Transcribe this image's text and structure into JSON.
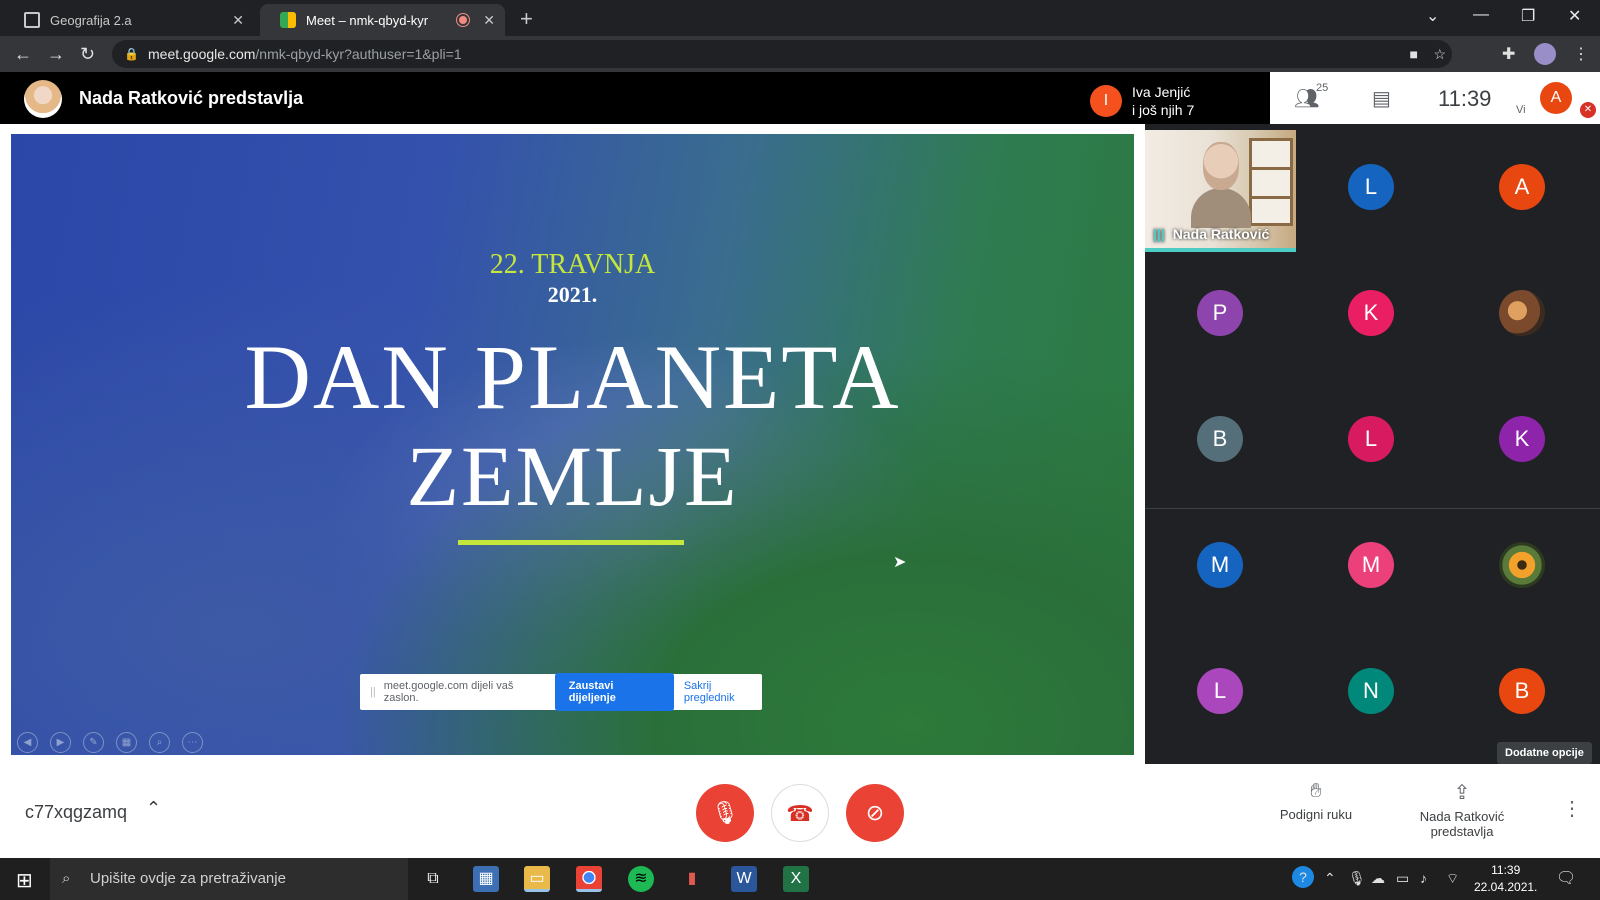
{
  "browser": {
    "tabs": [
      {
        "title": "Geografija 2.a",
        "close": "✕"
      },
      {
        "title": "Meet – nmk-qbyd-kyr",
        "close": "✕",
        "recording": true
      }
    ],
    "new_tab": "+",
    "url_host": "meet.google.com",
    "url_path": "/nmk-qbyd-kyr?authuser=1&pli=1"
  },
  "meet": {
    "presenter_title": "Nada Ratković predstavlja",
    "notification": {
      "initial": "I",
      "line1": "Iva Jenjić",
      "line2": "i još njih 7"
    },
    "participant_count": "25",
    "clock": "11:39",
    "self_label": "Vi",
    "self_initial": "A",
    "presenter_tile_name": "Nada Ratković",
    "participants": [
      {
        "initial": "L",
        "color": "#1565c0"
      },
      {
        "initial": "A",
        "color": "#e8470f"
      },
      {
        "initial": "P",
        "color": "#8e44ad"
      },
      {
        "initial": "K",
        "color": "#e91e63"
      },
      {
        "initial": "",
        "color": "photo"
      },
      {
        "initial": "B",
        "color": "#546e7a"
      },
      {
        "initial": "L",
        "color": "#d81b60"
      },
      {
        "initial": "K",
        "color": "#8e24aa"
      },
      {
        "initial": "M",
        "color": "#1565c0"
      },
      {
        "initial": "M",
        "color": "#ec407a"
      },
      {
        "initial": "",
        "color": "flower"
      },
      {
        "initial": "L",
        "color": "#ab47bc"
      },
      {
        "initial": "N",
        "color": "#00897b"
      },
      {
        "initial": "B",
        "color": "#e8470f"
      }
    ],
    "tooltip": "Dodatne opcije",
    "meeting_code": "c77xqgzamq",
    "raise_hand": "Podigni ruku",
    "presenting_line1": "Nada Ratković",
    "presenting_line2": "predstavlja"
  },
  "slide": {
    "date_line1": "22. TRAVNJA",
    "date_line2": "2021.",
    "title_line1": "DAN PLANETA",
    "title_line2": "ZEMLJE",
    "share_text": "meet.google.com dijeli vaš zaslon.",
    "stop_sharing": "Zaustavi dijeljenje",
    "hide": "Sakrij preglednik"
  },
  "taskbar": {
    "search_placeholder": "Upišite ovdje za pretraživanje",
    "time": "11:39",
    "date": "22.04.2021."
  },
  "colors": {
    "accent_green": "#c5e63a",
    "meet_red": "#ea4335",
    "meet_blue": "#1a73e8"
  }
}
